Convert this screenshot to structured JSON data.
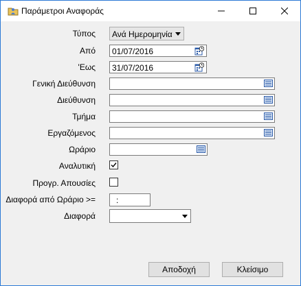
{
  "window": {
    "title": "Παράμετροι Αναφοράς"
  },
  "form": {
    "type_label": "Τύπος",
    "type_value": "Ανά Ημερομηνία",
    "from_label": "Από",
    "from_value": "01/07/2016",
    "to_label": "'Εως",
    "to_value": "31/07/2016",
    "general_directorate_label": "Γενική Διεύθυνση",
    "directorate_label": "Διεύθυνση",
    "department_label": "Τμήμα",
    "employee_label": "Εργαζόμενος",
    "schedule_label": "Ωράριο",
    "detailed_label": "Αναλυτική",
    "detailed_checked": true,
    "scheduled_absences_label": "Προγρ. Απουσίες",
    "scheduled_absences_checked": false,
    "schedule_diff_label": "Διαφορά από Ωράριο >=",
    "schedule_diff_value": ":",
    "difference_label": "Διαφορά",
    "difference_value": ""
  },
  "buttons": {
    "accept_label": "Αποδοχή",
    "close_label": "Κλείσιμο"
  },
  "icons": {
    "app": "folder-person-icon",
    "minimize": "minimize-icon",
    "maximize": "maximize-icon",
    "close": "close-icon",
    "calendar": "calendar-icon",
    "lookup": "lookup-list-icon",
    "check": "checkmark-icon",
    "dropdown": "chevron-down-icon"
  },
  "colors": {
    "window_border": "#2b79d6",
    "background": "#f0f0f0"
  }
}
